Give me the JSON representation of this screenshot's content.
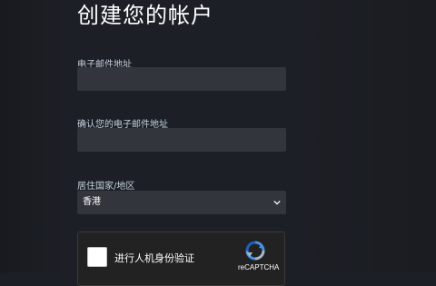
{
  "page": {
    "title": "创建您的帐户"
  },
  "form": {
    "email_label": "电子邮件地址",
    "email_value": "",
    "confirm_email_label": "确认您的电子邮件地址",
    "confirm_email_value": "",
    "country_label": "居住国家/地区",
    "country_selected": "香港"
  },
  "captcha": {
    "prompt": "进行人机身份验证",
    "brand": "reCAPTCHA",
    "logo_icon": "recaptcha-logo-icon"
  },
  "colors": {
    "background": "#1c1f25",
    "input_background": "#32353c",
    "captcha_background": "#222222",
    "captcha_blue": "#4a90e2"
  }
}
